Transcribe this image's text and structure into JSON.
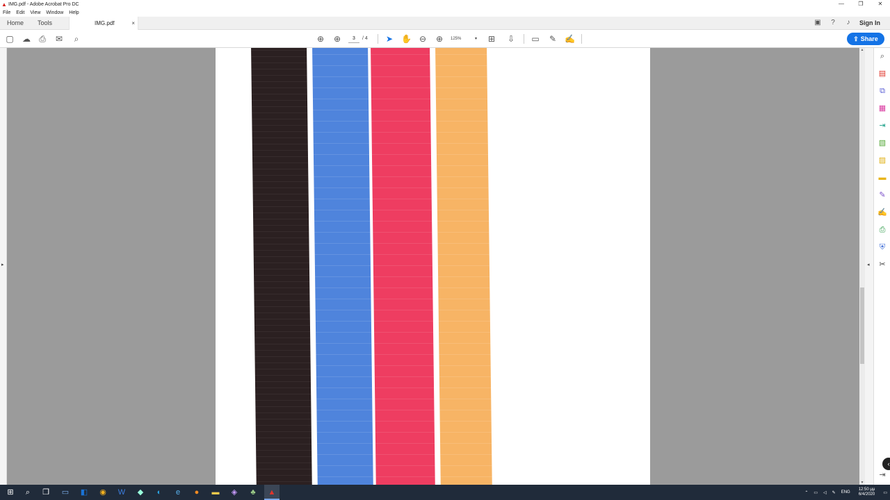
{
  "window": {
    "title": "IMG.pdf - Adobe Acrobat Pro DC",
    "app_icon": "acrobat-icon",
    "controls": [
      "—",
      "❐",
      "✕"
    ]
  },
  "menu": [
    "File",
    "Edit",
    "View",
    "Window",
    "Help"
  ],
  "tabs": {
    "home": "Home",
    "tools": "Tools",
    "document": "IMG.pdf",
    "close": "×"
  },
  "header_right": {
    "sign_in": "Sign In"
  },
  "toolbar": {
    "current_page": "3",
    "page_count": "/ 4",
    "zoom": "125%",
    "share_label": "Share"
  },
  "document": {
    "page": 3,
    "stripe_colors": [
      "#2b2021",
      "#4f84dc",
      "#ee3d61",
      "#f7b465"
    ]
  },
  "taskbar": {
    "language": "ENG",
    "time": "12:50 μμ",
    "date": "6/4/2020"
  }
}
